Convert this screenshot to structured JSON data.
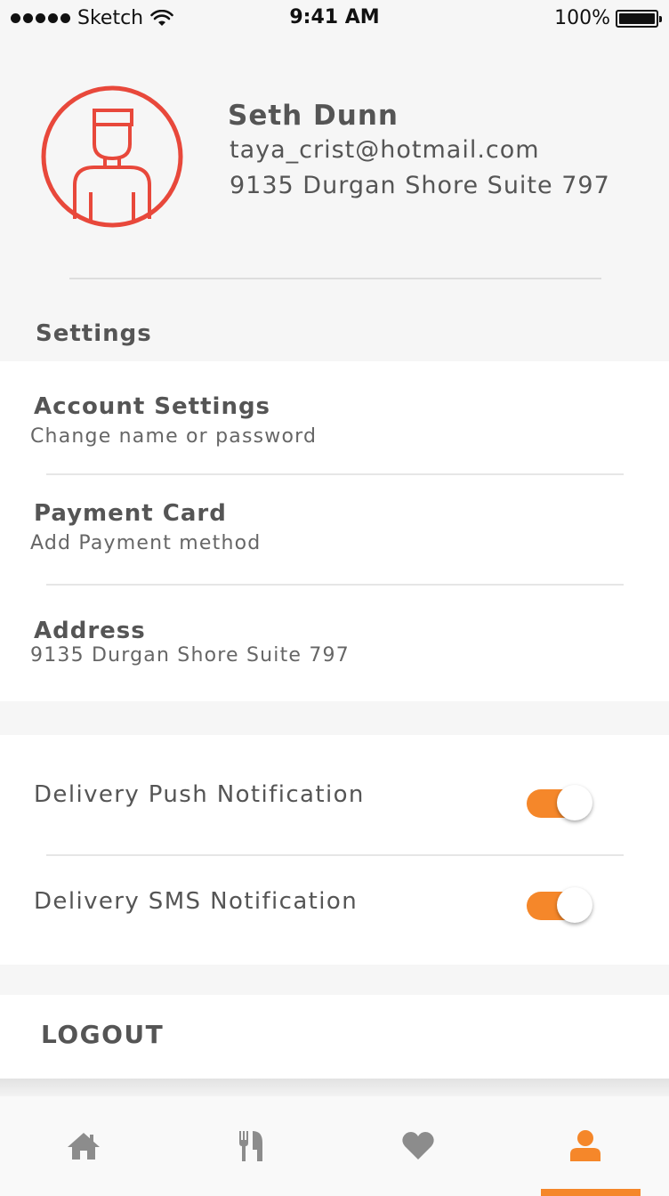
{
  "status_bar": {
    "carrier": "Sketch",
    "time": "9:41 AM",
    "battery": "100%"
  },
  "profile": {
    "name": "Seth Dunn",
    "email": "taya_crist@hotmail.com",
    "address": "9135 Durgan Shore Suite 797",
    "avatar_icon": "user-outline-icon"
  },
  "settings": {
    "heading": "Settings",
    "items": [
      {
        "title": "Account Settings",
        "subtitle": "Change name or password"
      },
      {
        "title": "Payment Card",
        "subtitle": "Add Payment method"
      },
      {
        "title": "Address",
        "subtitle": "9135 Durgan Shore Suite 797"
      }
    ]
  },
  "notifications": [
    {
      "label": "Delivery Push Notification",
      "enabled": true
    },
    {
      "label": "Delivery SMS Notification",
      "enabled": true
    }
  ],
  "logout": {
    "label": "LOGOUT"
  },
  "tab_bar": {
    "tabs": [
      {
        "icon": "home-icon",
        "active": false
      },
      {
        "icon": "fork-knife-icon",
        "active": false
      },
      {
        "icon": "heart-icon",
        "active": false
      },
      {
        "icon": "user-icon",
        "active": true
      }
    ]
  },
  "colors": {
    "accent": "#f5872a",
    "avatar_stroke": "#e8483b",
    "text": "#555555",
    "inactive_icon": "#8c8c8c",
    "background": "#f6f6f6"
  }
}
